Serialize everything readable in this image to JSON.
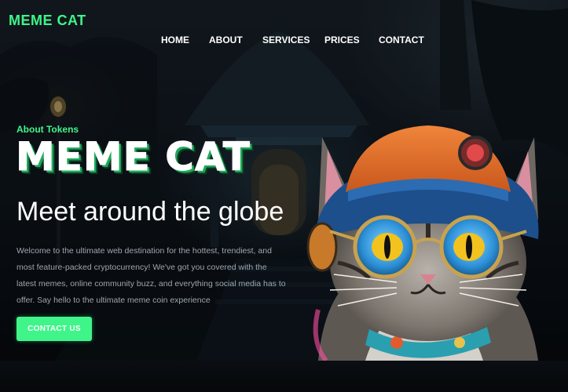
{
  "header": {
    "logo": "MEME CAT",
    "nav": [
      {
        "label": "HOME"
      },
      {
        "label": "ABOUT"
      },
      {
        "label": "SERVICES"
      },
      {
        "label": "PRICES"
      },
      {
        "label": "CONTACT"
      }
    ]
  },
  "hero": {
    "eyebrow": "About Tokens",
    "title": "MEME CAT",
    "subtitle": "Meet around the globe",
    "description": "Welcome to the ultimate web destination for the hottest, trendiest, and most feature-packed cryptocurrency! We've got you covered with the latest memes, online community buzz, and everything social media has to offer. Say hello to the ultimate meme coin experience",
    "cta_label": "CONTACT US"
  },
  "colors": {
    "accent": "#3ff58a",
    "background": "#0c1118",
    "text": "#ffffff",
    "muted_text": "#9ea6b0"
  },
  "icons": {
    "hero_image": "meme-cat-with-hat-and-glasses"
  }
}
